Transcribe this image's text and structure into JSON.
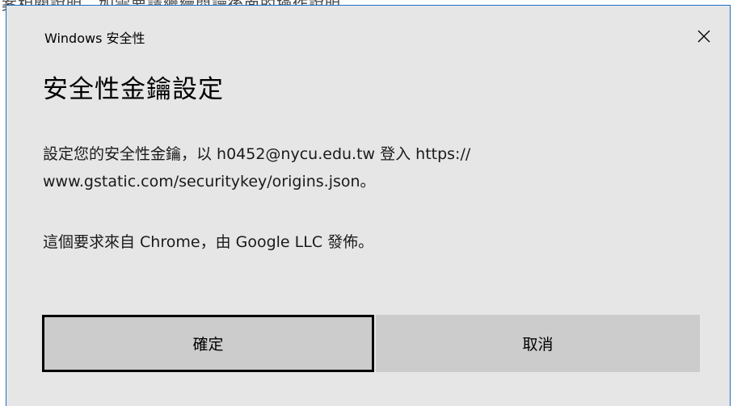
{
  "background": {
    "clipped_text": "案相關說明，如需要請繼續閱讀後面的操作說明"
  },
  "dialog": {
    "app_title": "Windows 安全性",
    "heading": "安全性金鑰設定",
    "message": "設定您的安全性金鑰，以 h0452@nycu.edu.tw 登入 https://www.gstatic.com/securitykey/origins.json。",
    "message_line1": "設定您的安全性金鑰，以 h0452@nycu.edu.tw 登入 https://",
    "message_line2": "www.gstatic.com/securitykey/origins.json。",
    "publisher": "這個要求來自 Chrome，由 Google LLC 發佈。",
    "close_icon": "close-icon",
    "buttons": {
      "ok_label": "確定",
      "cancel_label": "取消"
    }
  },
  "colors": {
    "dialog_background": "#e6e6e6",
    "dialog_border": "#1f6fc6",
    "button_background": "#cccccc",
    "focus_border": "#000000"
  }
}
